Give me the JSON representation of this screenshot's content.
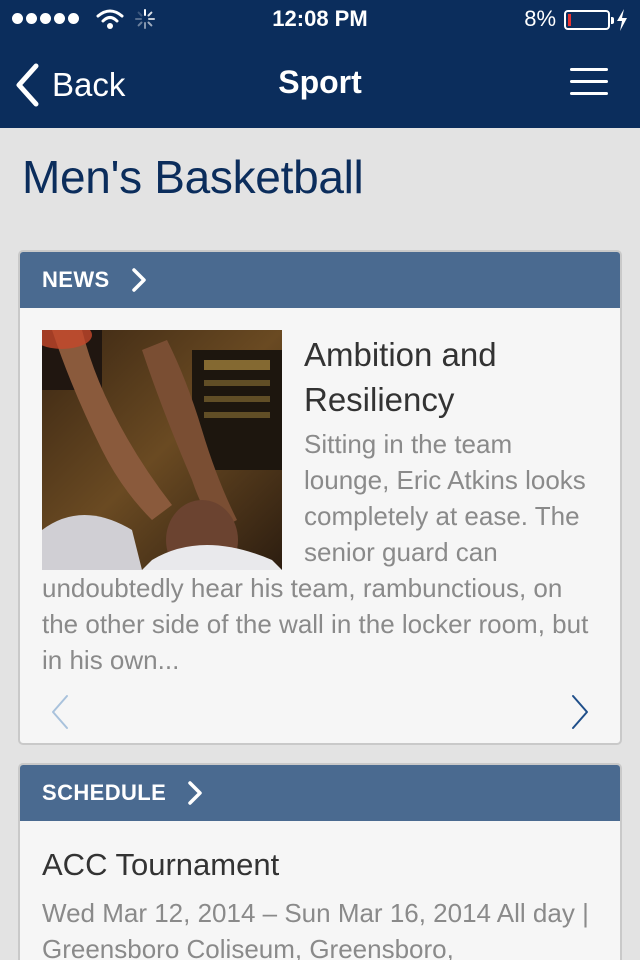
{
  "status_bar": {
    "time": "12:08 PM",
    "battery_percent": "8%",
    "battery_level": 0.08,
    "icons": [
      "signal-dots-icon",
      "wifi-icon",
      "activity-spinner-icon",
      "battery-icon",
      "charging-bolt-icon"
    ]
  },
  "nav": {
    "back_label": "Back",
    "title": "Sport",
    "icons": [
      "chevron-left-icon",
      "hamburger-menu-icon"
    ]
  },
  "page": {
    "title": "Men's Basketball"
  },
  "news": {
    "section_label": "NEWS",
    "headline": "Ambition and Resiliency",
    "excerpt": "Sitting in the team lounge, Eric Atkins looks completely at ease. The senior guard can undoubtedly hear his team, rambunctious, on the other side of the wall in the locker room, but in his own..."
  },
  "schedule": {
    "section_label": "SCHEDULE",
    "event_title": "ACC Tournament",
    "event_details": "Wed Mar 12, 2014 – Sun Mar 16, 2014 All day  | Greensboro Coliseum, Greensboro,"
  },
  "colors": {
    "nav_background": "#0b2d5c",
    "section_header": "#4a6a90",
    "title_text": "#0b2d5c",
    "page_background": "#e3e3e3",
    "battery_low": "#e8312f"
  }
}
